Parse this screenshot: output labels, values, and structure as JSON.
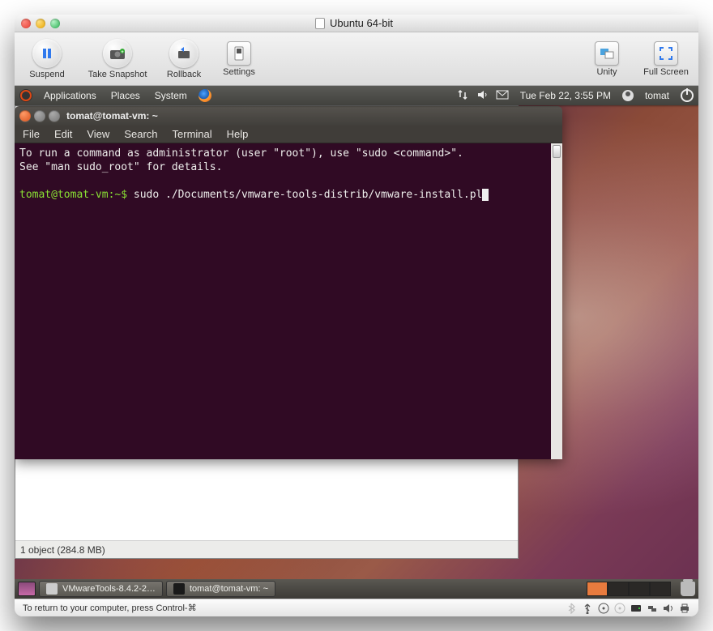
{
  "mac_window": {
    "title": "Ubuntu 64-bit"
  },
  "toolbar": {
    "suspend": "Suspend",
    "snapshot": "Take Snapshot",
    "rollback": "Rollback",
    "settings": "Settings",
    "unity": "Unity",
    "fullscreen": "Full Screen"
  },
  "gnome_top": {
    "applications": "Applications",
    "places": "Places",
    "system": "System",
    "clock": "Tue Feb 22,  3:55 PM",
    "user": "tomat"
  },
  "terminal": {
    "title": "tomat@tomat-vm: ~",
    "menu": {
      "file": "File",
      "edit": "Edit",
      "view": "View",
      "search": "Search",
      "terminal": "Terminal",
      "help": "Help"
    },
    "lines": {
      "l1": "To run a command as administrator (user \"root\"), use \"sudo <command>\".",
      "l2": "See \"man sudo_root\" for details.",
      "l3": "",
      "prompt": "tomat@tomat-vm:~$ ",
      "cmd": "sudo ./Documents/vmware-tools-distrib/vmware-install.pl"
    }
  },
  "nautilus": {
    "status": "1 object (284.8 MB)"
  },
  "taskbar": {
    "item1": "VMwareTools-8.4.2-2…",
    "item2": "tomat@tomat-vm: ~"
  },
  "mac_status": {
    "hint": "To return to your computer, press Control-⌘"
  }
}
